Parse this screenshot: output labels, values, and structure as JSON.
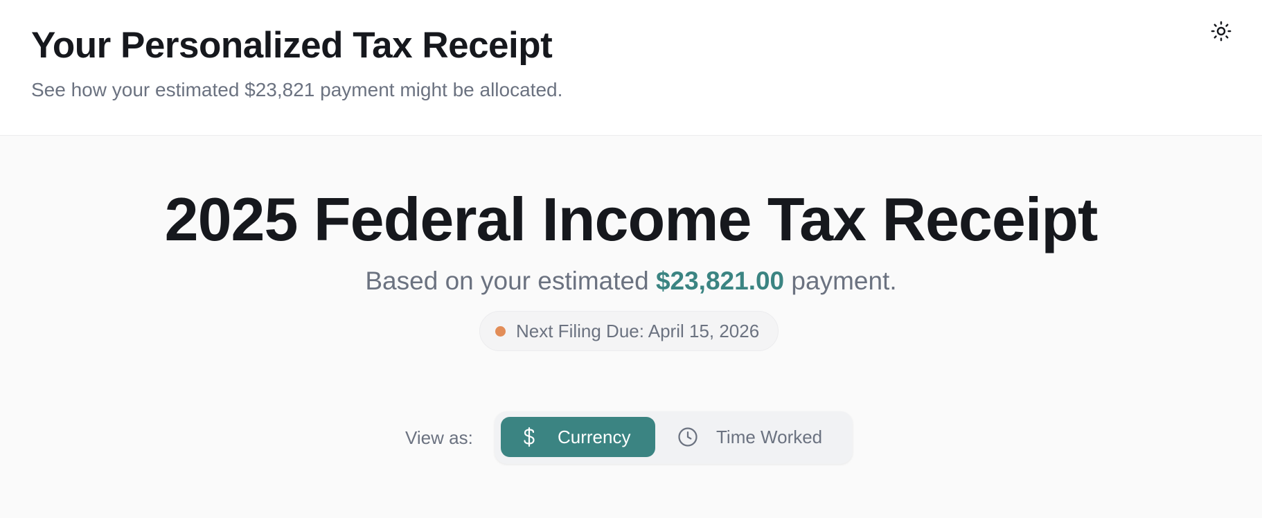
{
  "header": {
    "title": "Your Personalized Tax Receipt",
    "subtitle": "See how your estimated $23,821 payment might be allocated.",
    "theme_toggle_icon": "sun-icon"
  },
  "receipt": {
    "title": "2025 Federal Income Tax Receipt",
    "based_on_prefix": "Based on your estimated",
    "amount": "$23,821.00",
    "based_on_suffix": "payment.",
    "due_label": "Next Filing Due: April 15, 2026",
    "due_dot_color": "#e28d58"
  },
  "view_toggle": {
    "label": "View as:",
    "options": [
      {
        "label": "Currency",
        "icon": "dollar-icon",
        "selected": true
      },
      {
        "label": "Time Worked",
        "icon": "clock-icon",
        "selected": false
      }
    ]
  },
  "colors": {
    "accent": "#3b8482",
    "text": "#16181d",
    "muted": "#6b7280"
  }
}
